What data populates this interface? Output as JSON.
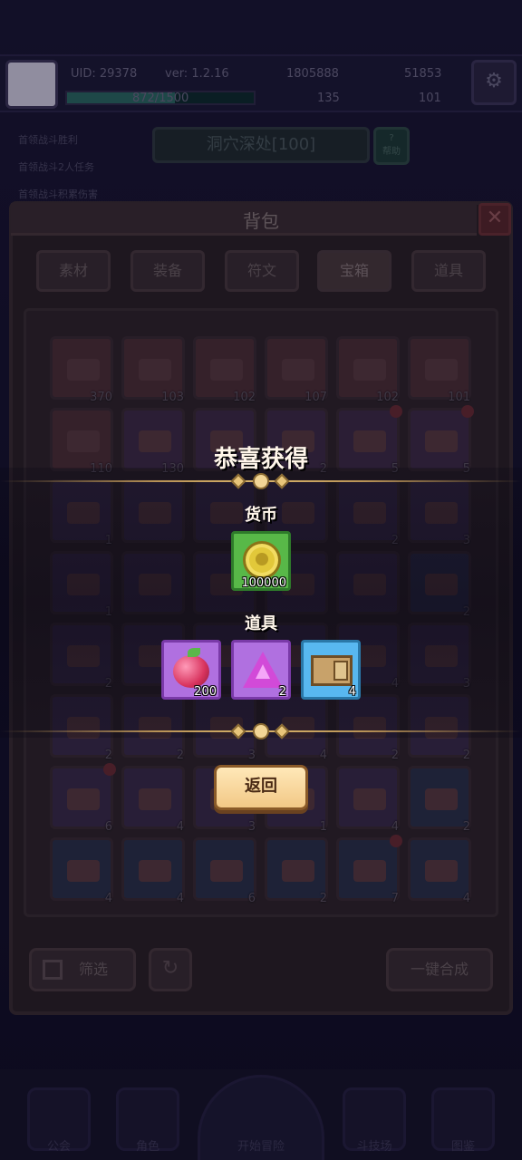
{
  "hud": {
    "uid": "UID: 29378",
    "version": "ver: 1.2.16",
    "currency_a": "1805888",
    "currency_b": "51853",
    "exp_text": "872/1500",
    "stat_a": "135",
    "stat_b": "101",
    "exp_progress": 0.58
  },
  "quests": [
    "首领战斗胜利",
    "首领战斗2人任务",
    "首领战斗积累伤害"
  ],
  "stage": {
    "name": "洞穴深处[100]",
    "help_label": "帮助"
  },
  "bag": {
    "title": "背包",
    "tabs": [
      "素材",
      "装备",
      "符文",
      "宝箱",
      "道具"
    ],
    "active_tab": "宝箱",
    "items": [
      {
        "count": "370",
        "color": "#4e2e34",
        "dot": false
      },
      {
        "count": "103",
        "color": "#4e2e34",
        "dot": false
      },
      {
        "count": "102",
        "color": "#4e2e34",
        "dot": false
      },
      {
        "count": "107",
        "color": "#4e2e34",
        "dot": false
      },
      {
        "count": "102",
        "color": "#4e2e34",
        "dot": false
      },
      {
        "count": "101",
        "color": "#4e2e34",
        "dot": false
      },
      {
        "count": "110",
        "color": "#4e2e34",
        "dot": false
      },
      {
        "count": "130",
        "color": "#3e2a44",
        "dot": false
      },
      {
        "count": "",
        "color": "#3e2a44",
        "dot": false
      },
      {
        "count": "2",
        "color": "#3e2a44",
        "dot": false
      },
      {
        "count": "5",
        "color": "#3e2a44",
        "dot": true
      },
      {
        "count": "5",
        "color": "#3e2a44",
        "dot": true
      },
      {
        "count": "1",
        "color": "#3a2a48",
        "dot": false
      },
      {
        "count": "",
        "color": "#3a2a48",
        "dot": false
      },
      {
        "count": "",
        "color": "#3a2a48",
        "dot": false
      },
      {
        "count": "",
        "color": "#3a2a48",
        "dot": false
      },
      {
        "count": "2",
        "color": "#3a2a48",
        "dot": false
      },
      {
        "count": "3",
        "color": "#3a2a48",
        "dot": false
      },
      {
        "count": "1",
        "color": "#3a2a48",
        "dot": false
      },
      {
        "count": "",
        "color": "#3a2a48",
        "dot": false
      },
      {
        "count": "",
        "color": "#3a2a48",
        "dot": false
      },
      {
        "count": "",
        "color": "#3a2a48",
        "dot": false
      },
      {
        "count": "",
        "color": "#3a2a48",
        "dot": false
      },
      {
        "count": "2",
        "color": "#2e2e4a",
        "dot": false
      },
      {
        "count": "2",
        "color": "#3a2a48",
        "dot": false
      },
      {
        "count": "",
        "color": "#3a2a48",
        "dot": false
      },
      {
        "count": "",
        "color": "#3a2a48",
        "dot": false
      },
      {
        "count": "",
        "color": "#3a2a48",
        "dot": false
      },
      {
        "count": "4",
        "color": "#3a2a48",
        "dot": false
      },
      {
        "count": "3",
        "color": "#3a2a48",
        "dot": false
      },
      {
        "count": "2",
        "color": "#3a2a48",
        "dot": false
      },
      {
        "count": "2",
        "color": "#3a2a48",
        "dot": false
      },
      {
        "count": "3",
        "color": "#3a2a48",
        "dot": false
      },
      {
        "count": "4",
        "color": "#3a2a48",
        "dot": false
      },
      {
        "count": "2",
        "color": "#3a2a48",
        "dot": false
      },
      {
        "count": "2",
        "color": "#3a2a48",
        "dot": false
      },
      {
        "count": "6",
        "color": "#3a2a48",
        "dot": true
      },
      {
        "count": "4",
        "color": "#3a2a48",
        "dot": false
      },
      {
        "count": "3",
        "color": "#3a2a48",
        "dot": false
      },
      {
        "count": "1",
        "color": "#3a2a48",
        "dot": false
      },
      {
        "count": "4",
        "color": "#3a2a48",
        "dot": false
      },
      {
        "count": "2",
        "color": "#2a3048",
        "dot": false
      },
      {
        "count": "4",
        "color": "#2a3048",
        "dot": false
      },
      {
        "count": "4",
        "color": "#2a3048",
        "dot": false
      },
      {
        "count": "6",
        "color": "#2a3048",
        "dot": false
      },
      {
        "count": "2",
        "color": "#2a3048",
        "dot": false
      },
      {
        "count": "7",
        "color": "#2a3048",
        "dot": true
      },
      {
        "count": "4",
        "color": "#2a3048",
        "dot": false
      }
    ],
    "filter_label": "筛选",
    "merge_label": "一键合成"
  },
  "nav": [
    "公会",
    "角色",
    "开始冒险",
    "斗技场",
    "图鉴"
  ],
  "reward": {
    "title": "恭喜获得",
    "currency_label": "货币",
    "currency_items": [
      {
        "icon": "gold-coin-icon",
        "count": "100000",
        "frame": "#58b848"
      }
    ],
    "items_label": "道具",
    "items": [
      {
        "icon": "raspberry-icon",
        "count": "200",
        "frame": "#b070e0"
      },
      {
        "icon": "purple-gem-icon",
        "count": "2",
        "frame": "#b070e0"
      },
      {
        "icon": "wooden-crate-icon",
        "count": "4",
        "frame": "#58b8f0"
      }
    ],
    "back_label": "返回"
  }
}
